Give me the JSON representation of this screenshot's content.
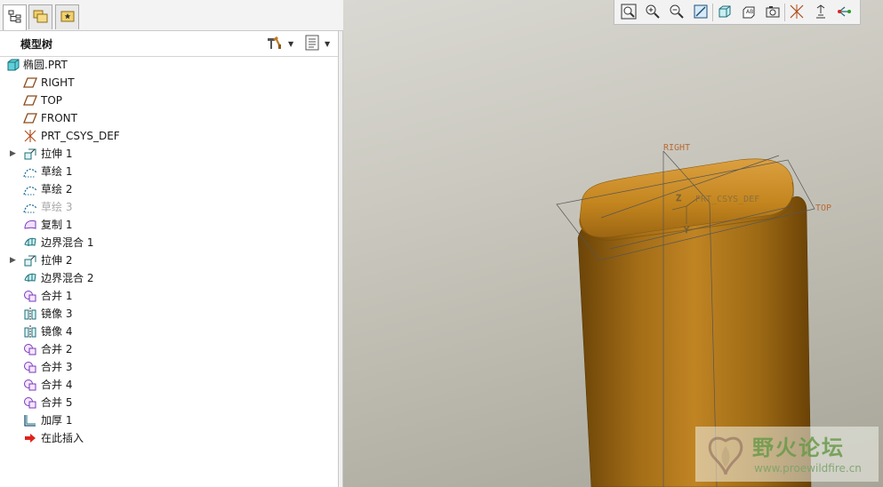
{
  "tabs": [
    {
      "icon": "model-tree-icon",
      "active": true
    },
    {
      "icon": "folder-browser-icon",
      "active": false
    },
    {
      "icon": "favorites-icon",
      "active": false
    }
  ],
  "tree_header": {
    "title": "模型树",
    "settings_icon": "tree-settings-icon",
    "show_icon": "tree-show-icon"
  },
  "tree": [
    {
      "label": "椭圆.PRT",
      "icon": "part-icon",
      "root": true
    },
    {
      "label": "RIGHT",
      "icon": "datum-plane-icon"
    },
    {
      "label": "TOP",
      "icon": "datum-plane-icon"
    },
    {
      "label": "FRONT",
      "icon": "datum-plane-icon"
    },
    {
      "label": "PRT_CSYS_DEF",
      "icon": "csys-icon"
    },
    {
      "label": "拉伸 1",
      "icon": "extrude-icon",
      "expandable": true
    },
    {
      "label": "草绘 1",
      "icon": "sketch-icon"
    },
    {
      "label": "草绘 2",
      "icon": "sketch-icon"
    },
    {
      "label": "草绘 3",
      "icon": "sketch-icon",
      "dimmed": true
    },
    {
      "label": "复制 1",
      "icon": "copy-icon"
    },
    {
      "label": "边界混合 1",
      "icon": "boundary-blend-icon"
    },
    {
      "label": "拉伸 2",
      "icon": "extrude-icon",
      "expandable": true
    },
    {
      "label": "边界混合 2",
      "icon": "boundary-blend-icon"
    },
    {
      "label": "合并 1",
      "icon": "merge-icon"
    },
    {
      "label": "镜像 3",
      "icon": "mirror-icon"
    },
    {
      "label": "镜像 4",
      "icon": "mirror-icon"
    },
    {
      "label": "合并 2",
      "icon": "merge-icon"
    },
    {
      "label": "合并 3",
      "icon": "merge-icon"
    },
    {
      "label": "合并 4",
      "icon": "merge-icon"
    },
    {
      "label": "合并 5",
      "icon": "merge-icon"
    },
    {
      "label": "加厚 1",
      "icon": "thicken-icon"
    },
    {
      "label": "在此插入",
      "icon": "insert-here-icon"
    }
  ],
  "view_toolbar": [
    {
      "icon": "refit-icon"
    },
    {
      "icon": "zoom-in-icon"
    },
    {
      "icon": "zoom-out-icon"
    },
    {
      "icon": "repaint-icon"
    },
    {
      "icon": "display-style-icon"
    },
    {
      "icon": "saved-orientations-icon"
    },
    {
      "icon": "view-manager-icon"
    },
    {
      "icon": "datum-display-filters-icon"
    },
    {
      "icon": "annotation-display-icon"
    },
    {
      "icon": "spin-center-icon"
    }
  ],
  "viewport": {
    "datum_labels": {
      "right": "RIGHT",
      "top": "TOP",
      "csys": "PRT_CSYS_DEF"
    },
    "model_color": "#c4861f"
  },
  "watermark": {
    "title": "野火论坛",
    "url": "www.proewildfire.cn"
  }
}
